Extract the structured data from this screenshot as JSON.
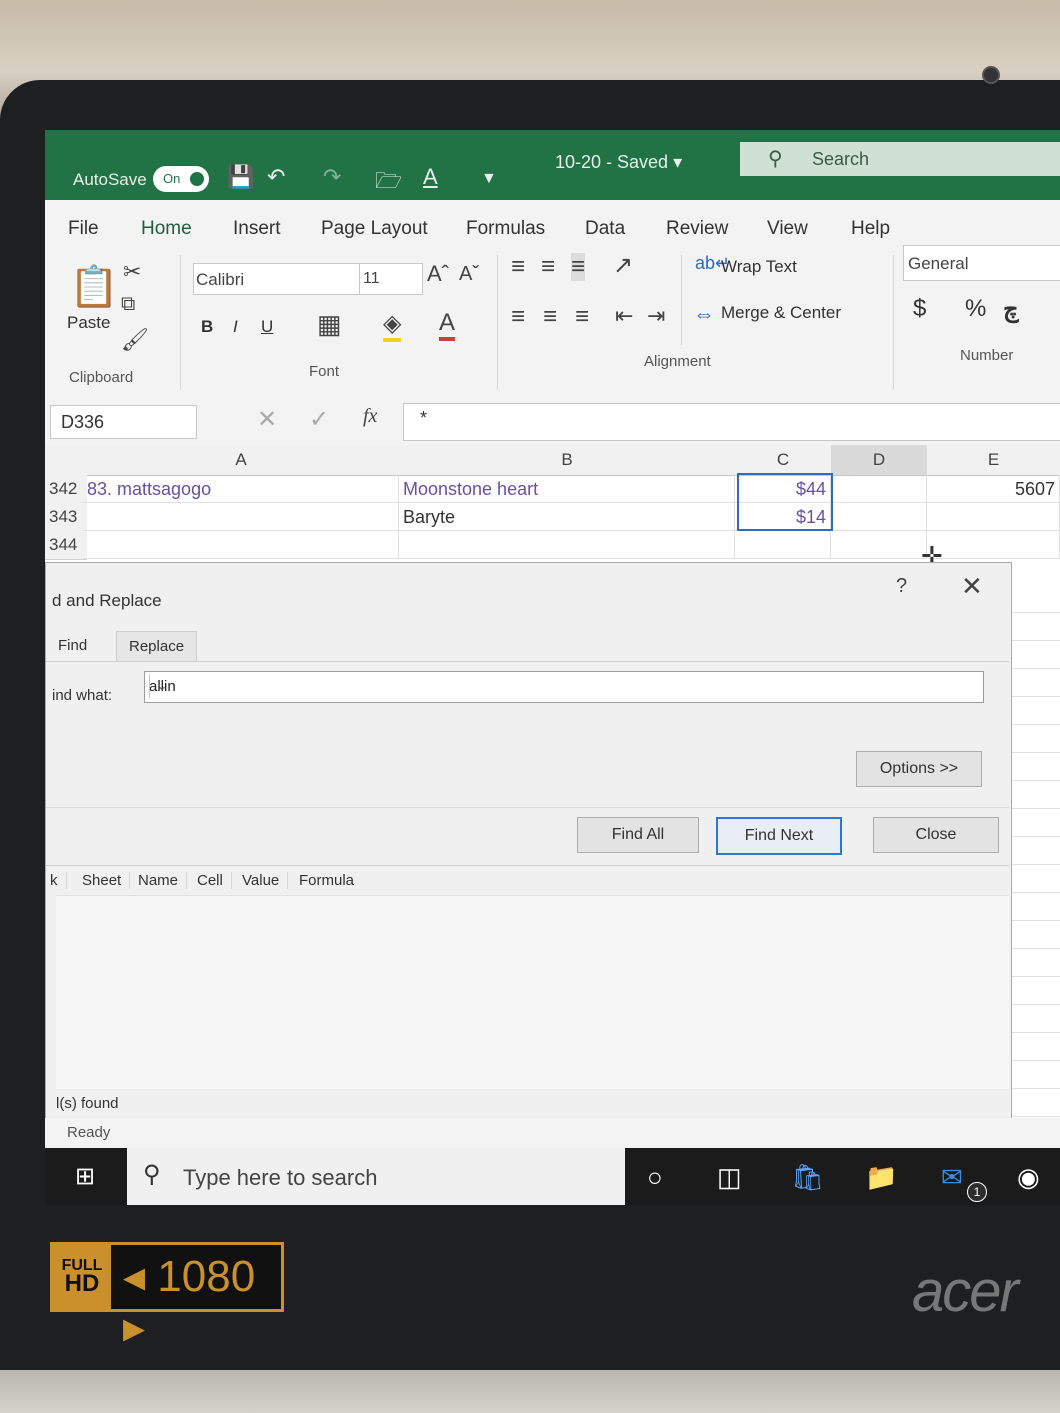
{
  "titlebar": {
    "autosave_label": "AutoSave",
    "autosave_state": "On",
    "doc_title": "10-20  -  Saved  ▾",
    "search_placeholder": "Search"
  },
  "menu": {
    "items": [
      "File",
      "Home",
      "Insert",
      "Page Layout",
      "Formulas",
      "Data",
      "Review",
      "View",
      "Help"
    ],
    "active": "Home"
  },
  "ribbon": {
    "clipboard": {
      "paste": "Paste",
      "group_label": "Clipboard"
    },
    "font": {
      "family": "Calibri",
      "size": "11",
      "group_label": "Font",
      "bold": "B",
      "italic": "I",
      "underline": "U"
    },
    "alignment": {
      "wrap_text": "Wrap Text",
      "merge_center": "Merge & Center",
      "group_label": "Alignment"
    },
    "number": {
      "format": "General",
      "currency": "$",
      "percent": "%",
      "comma": "چ",
      "group_label": "Number"
    }
  },
  "formula_bar": {
    "name_box": "D336",
    "fx": "fx",
    "content": "*"
  },
  "sheet": {
    "columns": [
      "A",
      "B",
      "C",
      "D",
      "E"
    ],
    "selected_column": "D",
    "rows": [
      {
        "num": "342",
        "A": "83. mattsagogo",
        "B": "Moonstone heart",
        "C": "$44",
        "D": "",
        "E": "5607"
      },
      {
        "num": "343",
        "A": "",
        "B": "Baryte",
        "C": "$14",
        "D": "",
        "E": ""
      },
      {
        "num": "344",
        "A": "",
        "B": "",
        "C": "",
        "D": "",
        "E": ""
      }
    ]
  },
  "dialog": {
    "title": "d and Replace",
    "help": "?",
    "tabs": [
      "Find",
      "Replace"
    ],
    "active_tab": "Find",
    "find_what_label": "ind what:",
    "find_what_value": "allin",
    "options_button": "Options >>",
    "find_all_button": "Find All",
    "find_next_button": "Find Next",
    "close_button": "Close",
    "result_columns": [
      "k",
      "Sheet",
      "Name",
      "Cell",
      "Value",
      "Formula"
    ],
    "found_text": "l(s) found"
  },
  "status": {
    "ready": "Ready"
  },
  "taskbar": {
    "search_placeholder": "Type here to search",
    "mail_badge": "1"
  },
  "sticker": {
    "full": "FULL",
    "hd": "HD",
    "resolution": "◂ 1080 ▸"
  },
  "brand": "acer",
  "colors": {
    "excel_green": "#217346",
    "selection_blue": "#2b6cc4",
    "hyperlink_purple": "#6a4fa0"
  }
}
